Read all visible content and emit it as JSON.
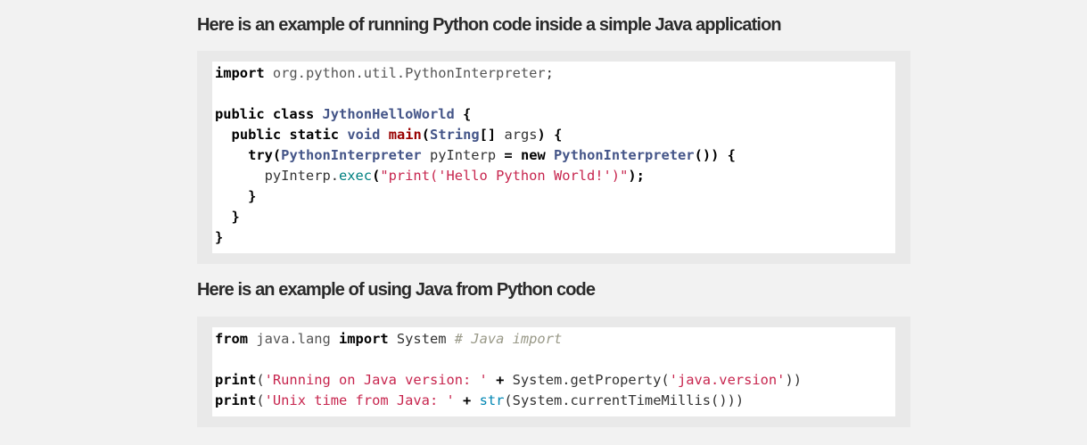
{
  "section1": {
    "heading": "Here is an example of running Python code inside a simple Java application",
    "lines": [
      [
        {
          "t": "import",
          "c": "kw"
        },
        {
          "t": " org.python.util.PythonInterpreter",
          "c": "nm"
        },
        {
          "t": ";",
          "c": "pl"
        }
      ],
      [],
      [
        {
          "t": "public",
          "c": "kw"
        },
        {
          "t": " ",
          "c": "pl"
        },
        {
          "t": "class",
          "c": "kw"
        },
        {
          "t": " ",
          "c": "pl"
        },
        {
          "t": "JythonHelloWorld",
          "c": "cls"
        },
        {
          "t": " {",
          "c": "kw"
        }
      ],
      [
        {
          "t": "  ",
          "c": "pl"
        },
        {
          "t": "public",
          "c": "kw"
        },
        {
          "t": " ",
          "c": "pl"
        },
        {
          "t": "static",
          "c": "kw"
        },
        {
          "t": " ",
          "c": "pl"
        },
        {
          "t": "void",
          "c": "tp"
        },
        {
          "t": " ",
          "c": "pl"
        },
        {
          "t": "main",
          "c": "fn"
        },
        {
          "t": "(",
          "c": "kw"
        },
        {
          "t": "String",
          "c": "cls"
        },
        {
          "t": "[]",
          "c": "kw"
        },
        {
          "t": " args",
          "c": "pl"
        },
        {
          "t": ") {",
          "c": "kw"
        }
      ],
      [
        {
          "t": "    ",
          "c": "pl"
        },
        {
          "t": "try",
          "c": "kw"
        },
        {
          "t": "(",
          "c": "kw"
        },
        {
          "t": "PythonInterpreter",
          "c": "cls"
        },
        {
          "t": " pyInterp ",
          "c": "pl"
        },
        {
          "t": "=",
          "c": "kw"
        },
        {
          "t": " ",
          "c": "pl"
        },
        {
          "t": "new",
          "c": "kw"
        },
        {
          "t": " ",
          "c": "pl"
        },
        {
          "t": "PythonInterpreter",
          "c": "cls"
        },
        {
          "t": "()) {",
          "c": "kw"
        }
      ],
      [
        {
          "t": "      pyInterp.",
          "c": "pl"
        },
        {
          "t": "exec",
          "c": "mt"
        },
        {
          "t": "(",
          "c": "kw"
        },
        {
          "t": "\"print('Hello Python World!')\"",
          "c": "str"
        },
        {
          "t": ");",
          "c": "kw"
        }
      ],
      [
        {
          "t": "    ",
          "c": "pl"
        },
        {
          "t": "}",
          "c": "kw"
        }
      ],
      [
        {
          "t": "  ",
          "c": "pl"
        },
        {
          "t": "}",
          "c": "kw"
        }
      ],
      [
        {
          "t": "}",
          "c": "kw"
        }
      ]
    ]
  },
  "section2": {
    "heading": "Here is an example of using Java from Python code",
    "lines": [
      [
        {
          "t": "from",
          "c": "kw"
        },
        {
          "t": " java.lang ",
          "c": "nm"
        },
        {
          "t": "import",
          "c": "kw"
        },
        {
          "t": " System ",
          "c": "pl"
        },
        {
          "t": "# Java import",
          "c": "cm"
        }
      ],
      [],
      [
        {
          "t": "print",
          "c": "kw"
        },
        {
          "t": "(",
          "c": "pl"
        },
        {
          "t": "'Running on Java version: '",
          "c": "str"
        },
        {
          "t": " ",
          "c": "pl"
        },
        {
          "t": "+",
          "c": "kw"
        },
        {
          "t": " System.getProperty(",
          "c": "pl"
        },
        {
          "t": "'java.version'",
          "c": "str"
        },
        {
          "t": "))",
          "c": "pl"
        }
      ],
      [
        {
          "t": "print",
          "c": "kw"
        },
        {
          "t": "(",
          "c": "pl"
        },
        {
          "t": "'Unix time from Java: '",
          "c": "str"
        },
        {
          "t": " ",
          "c": "pl"
        },
        {
          "t": "+",
          "c": "kw"
        },
        {
          "t": " ",
          "c": "pl"
        },
        {
          "t": "str",
          "c": "bi"
        },
        {
          "t": "(System.currentTimeMillis()))",
          "c": "pl"
        }
      ]
    ]
  }
}
